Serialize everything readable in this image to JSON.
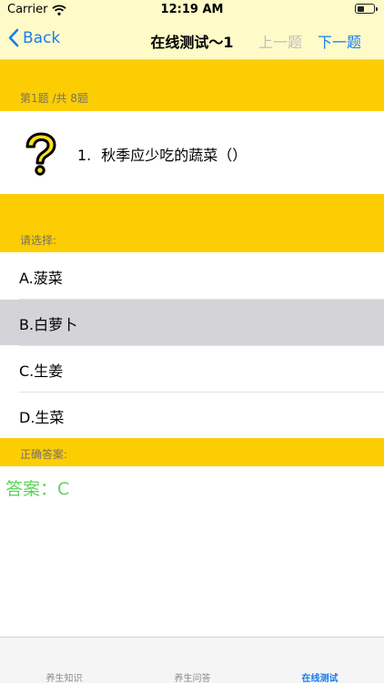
{
  "status_bar": {
    "carrier": "Carrier",
    "time": "12:19 AM",
    "battery_level": 0.45
  },
  "nav": {
    "back_label": "Back",
    "title": "在线测试～1",
    "prev_label": "上一题",
    "next_label": "下一题"
  },
  "quiz": {
    "progress": "第1题 /共 8题",
    "question_number": "1.",
    "question_text": "秋季应少吃的蔬菜（）",
    "question_icon": "question-mark-icon",
    "choose_label": "请选择:",
    "options": [
      {
        "label": "A.菠菜",
        "selected": false
      },
      {
        "label": "B.白萝卜",
        "selected": true
      },
      {
        "label": "C.生姜",
        "selected": false
      },
      {
        "label": "D.生菜",
        "selected": false
      }
    ],
    "correct_answer_label": "正确答案:",
    "answer_text": "答案：C"
  },
  "tabs": [
    {
      "label": "养生知识",
      "active": false
    },
    {
      "label": "养生问答",
      "active": false
    },
    {
      "label": "在线测试",
      "active": true
    }
  ],
  "colors": {
    "nav_background": "#fefbc8",
    "band": "#fdcd04",
    "accent": "#1a7cf0",
    "answer": "#5bd75b",
    "selected_option": "#d3d3d8"
  }
}
